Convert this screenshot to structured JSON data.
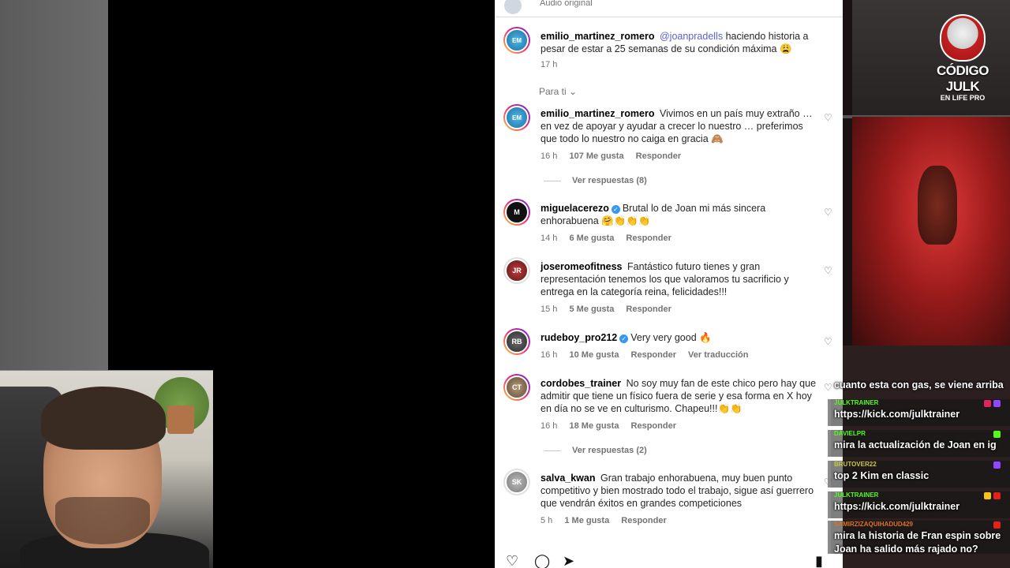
{
  "instagram": {
    "audio_label": "Audio original",
    "caption": {
      "user": "emilio_martinez_romero",
      "mention": "@joanpradells",
      "text": "haciendo historia a pesar de estar a 25 semanas de su condición máxima 😩",
      "time": "17 h"
    },
    "filter_label": "Para ti",
    "comments": [
      {
        "user": "emilio_martinez_romero",
        "verified": false,
        "text": "Vivimos en un país muy extraño … en vez de apoyar y ayudar a crecer lo nuestro … preferimos que todo lo nuestro no caiga en gracia 🙈",
        "time": "16 h",
        "likes": "107 Me gusta",
        "reply": "Responder",
        "view_replies": "Ver respuestas (8)"
      },
      {
        "user": "miguelacerezo",
        "verified": true,
        "text": "Brutal lo de Joan mi más sincera enhorabuena 🤗👏👏👏",
        "time": "14 h",
        "likes": "6 Me gusta",
        "reply": "Responder"
      },
      {
        "user": "joseromeofitness",
        "verified": false,
        "text": "Fantástico futuro tienes y gran representación tenemos los que valoramos tu sacrificio y entrega en la categoría reina, felicidades!!!",
        "time": "15 h",
        "likes": "5 Me gusta",
        "reply": "Responder"
      },
      {
        "user": "rudeboy_pro212",
        "verified": true,
        "text": "Very very good 🔥",
        "time": "16 h",
        "likes": "10 Me gusta",
        "reply": "Responder",
        "translate": "Ver traducción"
      },
      {
        "user": "cordobes_trainer",
        "verified": false,
        "text": "No soy muy fan de este chico pero hay que admitir que tiene un físico fuera de serie y esa forma en X hoy en día no se ve en culturismo. Chapeu!!!👏👏",
        "time": "16 h",
        "likes": "18 Me gusta",
        "reply": "Responder",
        "view_replies": "Ver respuestas (2)"
      },
      {
        "user": "salva_kwan",
        "verified": false,
        "text": "Gran trabajo enhorabuena, muy buen punto competitivo y bien mostrado todo el trabajo, sigue así guerrero que vendrán éxitos en grandes competiciones",
        "time": "5 h",
        "likes": "1 Me gusta",
        "reply": "Responder"
      }
    ]
  },
  "stream": {
    "logo_title": "CÓDIGO JULK",
    "logo_subtitle": "EN LIFE PRO"
  },
  "chat": [
    {
      "user": "",
      "text": "cuanto esta con gas, se viene arriba",
      "color": "#ffffff"
    },
    {
      "user": "JULKTRAINER",
      "text": "https://kick.com/julktrainer",
      "color": "#53fc18"
    },
    {
      "user": "DAVIELPR",
      "text": "mira la actualización de Joan en ig",
      "color": "#53fc18"
    },
    {
      "user": "BRUTOVER22",
      "text": "top 2 Kim en classic",
      "color": "#c9c93a"
    },
    {
      "user": "JULKTRAINER",
      "text": "https://kick.com/julktrainer",
      "color": "#53fc18"
    },
    {
      "user": "SAMIRZIZAQUIHADUD429",
      "text": "mira la historia de Fran espin sobre Joan ha salido más rajado no?",
      "color": "#e0701f"
    }
  ]
}
